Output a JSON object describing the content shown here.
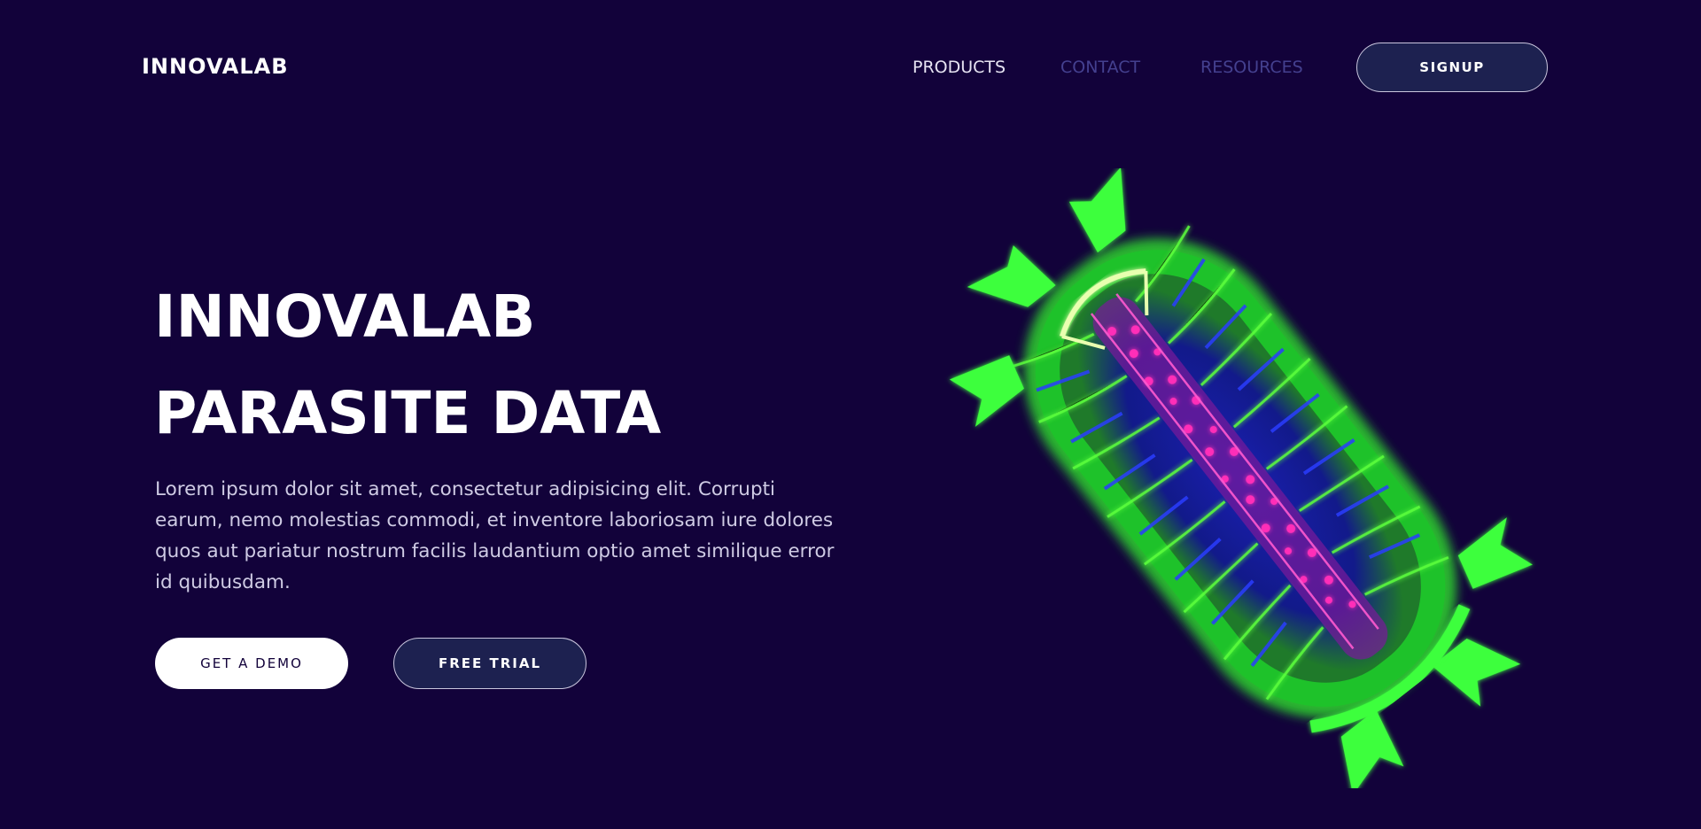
{
  "nav": {
    "logo": "INNOVALAB",
    "links": [
      {
        "label": "PRODUCTS",
        "active": true
      },
      {
        "label": "CONTACT",
        "active": false
      },
      {
        "label": "RESOURCES",
        "active": false
      }
    ],
    "signup_label": "SIGNUP"
  },
  "hero": {
    "title_line1": "INNOVALAB",
    "title_line2": "PARASITE DATA",
    "description": "Lorem ipsum dolor sit amet, consectetur adipisicing elit. Corrupti earum, nemo molestias commodi, et inventore laboriosam iure dolores quos aut pariatur nostrum facilis laudantium optio amet similique error id quibusdam.",
    "demo_label": "GET A DEMO",
    "trial_label": "FREE TRIAL"
  },
  "colors": {
    "background": "#12023a",
    "nav_inactive": "#44408f",
    "button_dark": "#1d2150",
    "specimen_green": "#39ff3a",
    "specimen_magenta": "#ff2fb8",
    "specimen_blue": "#2a3dff"
  },
  "image": {
    "icon": "parasite-micrograph"
  }
}
